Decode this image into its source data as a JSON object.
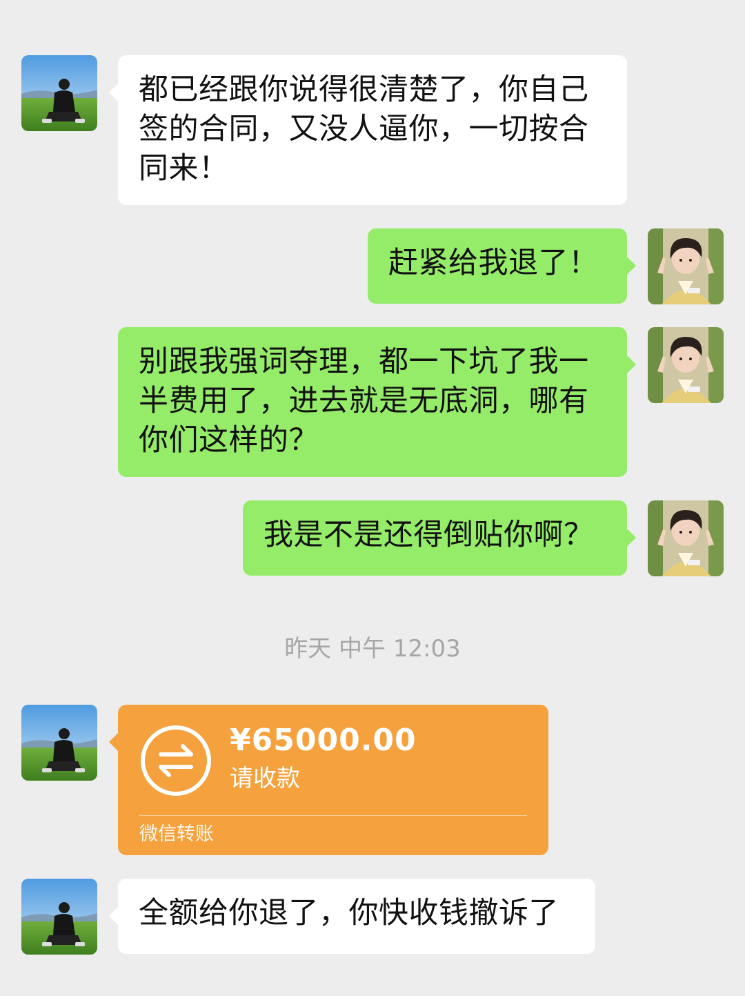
{
  "messages": [
    {
      "text": "都已经跟你说得很清楚了，你自己签的合同，又没人逼你，一切按合同来！"
    },
    {
      "text": "赶紧给我退了！"
    },
    {
      "text": "别跟我强词夺理，都一下坑了我一半费用了，进去就是无底洞，哪有你们这样的？"
    },
    {
      "text": "我是不是还得倒贴你啊？"
    },
    {
      "text": "全额给你退了，你快收钱撤诉了"
    }
  ],
  "timestamp": "昨天 中午 12:03",
  "transfer": {
    "amount": "¥65000.00",
    "status": "请收款",
    "footer": "微信转账",
    "icon": "transfer-arrows-icon"
  },
  "colors": {
    "background": "#ededed",
    "incoming_bubble": "#ffffff",
    "outgoing_bubble": "#95ec69",
    "transfer_card": "#f5a23e",
    "timestamp_text": "#a6a6a6"
  }
}
